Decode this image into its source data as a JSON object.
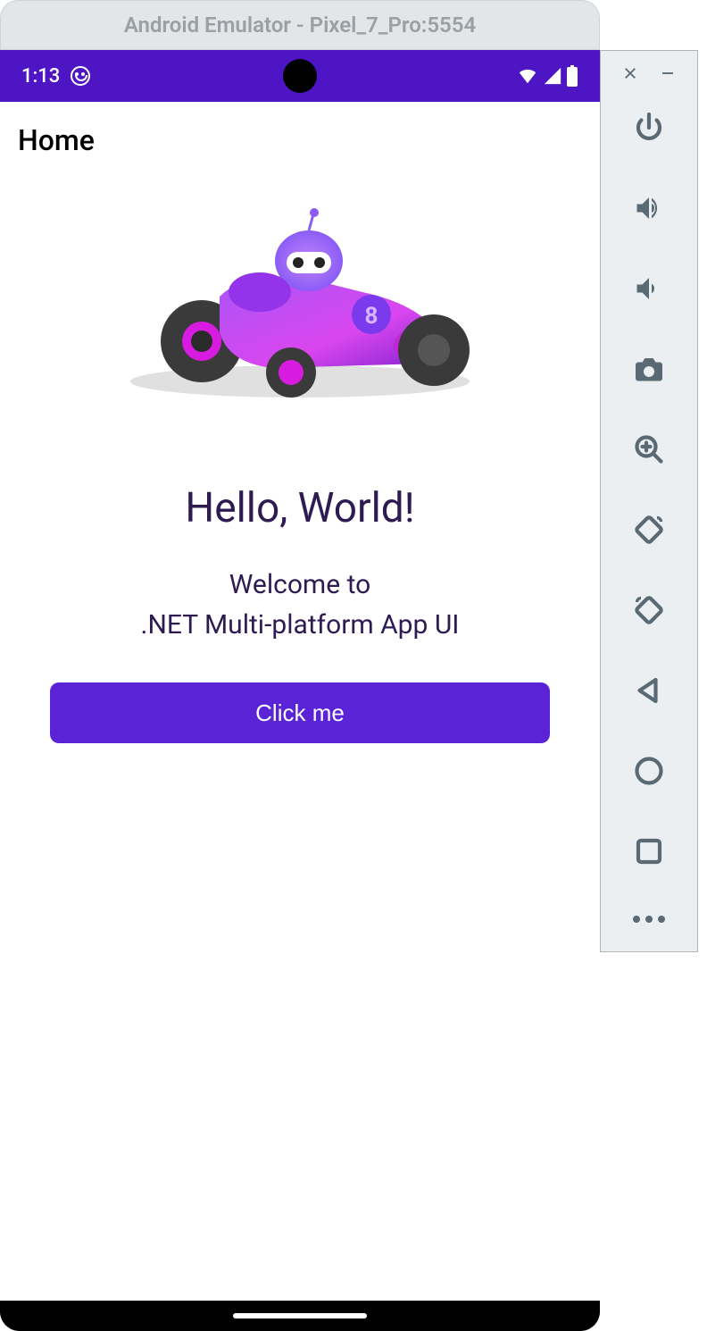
{
  "window": {
    "title": "Android Emulator - Pixel_7_Pro:5554"
  },
  "statusbar": {
    "time": "1:13"
  },
  "app": {
    "header_title": "Home",
    "hello": "Hello, World!",
    "welcome_line1": "Welcome to",
    "welcome_line2": ".NET Multi-platform App UI",
    "button_label": "Click me"
  },
  "toolbar": {
    "close": "Close",
    "minimize": "Minimize",
    "power": "power-icon",
    "volume_up": "volume-up-icon",
    "volume_down": "volume-down-icon",
    "camera": "camera-icon",
    "zoom": "zoom-icon",
    "rotate_left": "rotate-left-icon",
    "rotate_right": "rotate-right-icon",
    "back": "back-icon",
    "home": "home-icon",
    "overview": "overview-icon",
    "more": "more-icon"
  },
  "colors": {
    "primary": "#4d15c3",
    "button": "#5a24d6",
    "text": "#2d1b52"
  }
}
